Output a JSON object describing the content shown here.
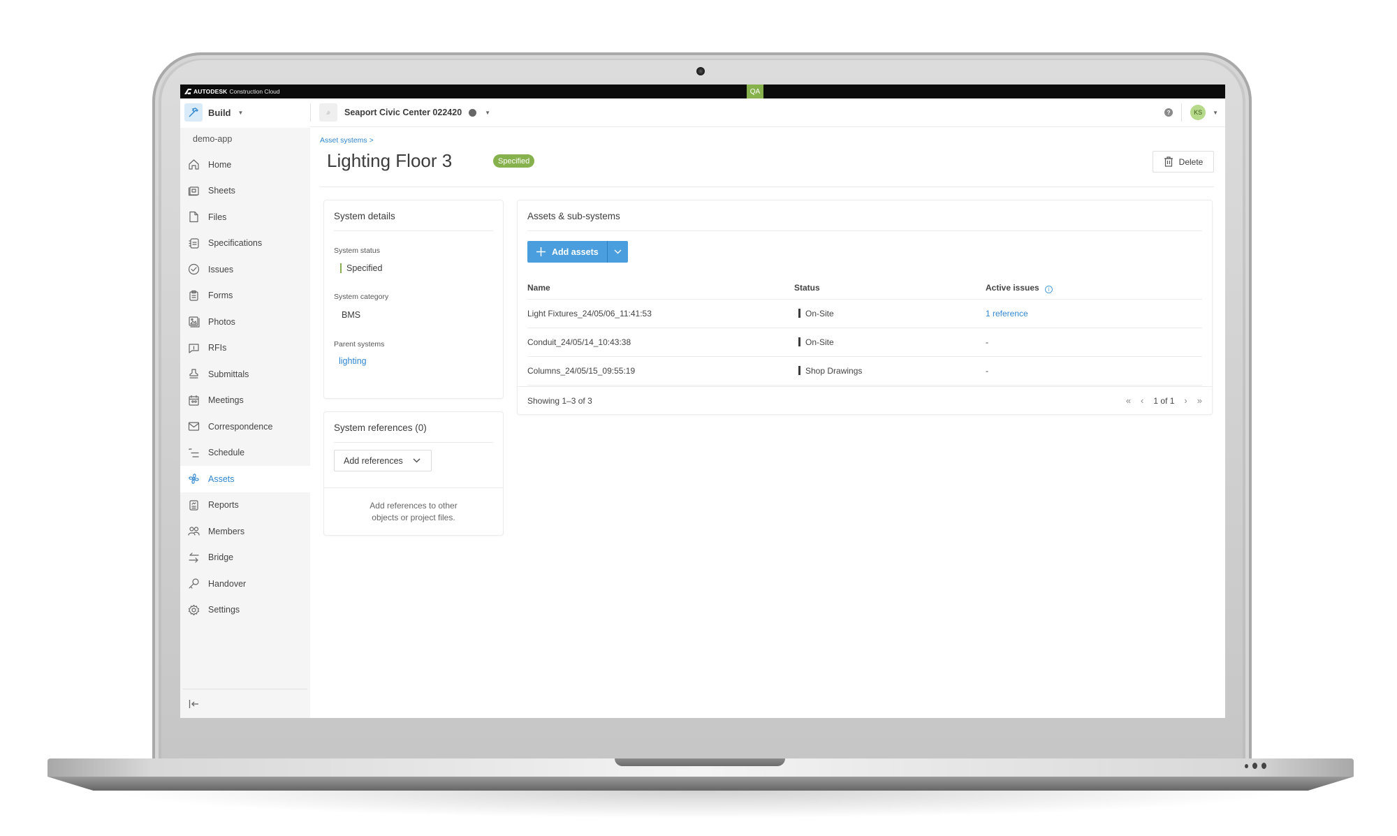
{
  "topbar": {
    "brand_strong": "AUTODESK",
    "brand_light": "Construction Cloud",
    "env_badge": "QA"
  },
  "header": {
    "product": "Build",
    "project": "Seaport Civic Center 022420",
    "user_initials": "KS",
    "help": "?",
    "corner_badge": "QA"
  },
  "sidebar": {
    "org": "demo-app",
    "items": [
      {
        "label": "Home",
        "icon": "home-icon"
      },
      {
        "label": "Sheets",
        "icon": "sheets-icon"
      },
      {
        "label": "Files",
        "icon": "file-icon"
      },
      {
        "label": "Specifications",
        "icon": "specifications-icon"
      },
      {
        "label": "Issues",
        "icon": "check-circle-icon"
      },
      {
        "label": "Forms",
        "icon": "clipboard-icon"
      },
      {
        "label": "Photos",
        "icon": "photo-icon"
      },
      {
        "label": "RFIs",
        "icon": "rfi-icon"
      },
      {
        "label": "Submittals",
        "icon": "stamp-icon"
      },
      {
        "label": "Meetings",
        "icon": "calendar-people-icon"
      },
      {
        "label": "Correspondence",
        "icon": "envelope-icon"
      },
      {
        "label": "Schedule",
        "icon": "schedule-icon"
      },
      {
        "label": "Assets",
        "icon": "assets-fan-icon",
        "active": true
      },
      {
        "label": "Reports",
        "icon": "report-icon"
      },
      {
        "label": "Members",
        "icon": "members-icon"
      },
      {
        "label": "Bridge",
        "icon": "bridge-arrows-icon"
      },
      {
        "label": "Handover",
        "icon": "key-icon"
      },
      {
        "label": "Settings",
        "icon": "gear-icon"
      }
    ],
    "collapse_icon": "collapse-left-icon"
  },
  "page": {
    "breadcrumb": "Asset systems >",
    "title": "Lighting Floor 3",
    "status_badge": "Specified",
    "delete_label": "Delete"
  },
  "system_details": {
    "title": "System details",
    "status_label": "System status",
    "status_value": "Specified",
    "category_label": "System category",
    "category_value": "BMS",
    "parent_label": "Parent systems",
    "parent_value": "lighting"
  },
  "system_references": {
    "title": "System references (0)",
    "add_label": "Add references",
    "empty_line1": "Add references to other",
    "empty_line2": "objects or project files."
  },
  "assets": {
    "title": "Assets & sub-systems",
    "add_label": "Add assets",
    "columns": {
      "name": "Name",
      "status": "Status",
      "issues": "Active issues"
    },
    "rows": [
      {
        "name": "Light Fixtures_24/05/06_11:41:53",
        "status": "On-Site",
        "issues": "1 reference",
        "issues_link": true
      },
      {
        "name": "Conduit_24/05/14_10:43:38",
        "status": "On-Site",
        "issues": "-",
        "issues_link": false
      },
      {
        "name": "Columns_24/05/15_09:55:19",
        "status": "Shop Drawings",
        "issues": "-",
        "issues_link": false
      }
    ],
    "showing": "Showing 1–3 of 3",
    "page_label": "1 of 1"
  },
  "colors": {
    "accent_blue": "#2f86d0",
    "button_blue": "#4b9ede",
    "status_green": "#86b14c",
    "topbar_black": "#0c0c0c"
  }
}
